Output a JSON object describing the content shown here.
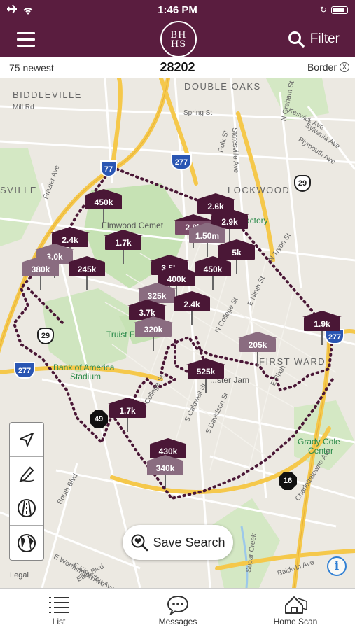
{
  "status_bar": {
    "time": "1:46 PM"
  },
  "header": {
    "logo_line1": "BH",
    "logo_line2": "HS",
    "filter_label": "Filter"
  },
  "info_bar": {
    "newest": "75 newest",
    "zip": "28202",
    "border_label": "Border",
    "border_close": "x"
  },
  "map": {
    "labels": {
      "biddleville": "BIDDLEVILLE",
      "double_oaks": "DOUBLE OAKS",
      "lockwood": "LOCKWOOD",
      "first_ward": "FIRST WARD",
      "sville": "SVILLE",
      "elmwood": "Elmwood Cemet",
      "truist": "Truist Field",
      "boa": "Bank of America",
      "stadium": "Stadium",
      "grady1": "Grady Cole",
      "grady2": "Center",
      "factory": "actory",
      "spring": "Spring St",
      "mill": "Mill Rd",
      "statesville": "Statesville Ave",
      "ngraham": "N Graham St",
      "ntryon": "N Tryon St",
      "ncollege": "N College St",
      "scaldwell": "S Caldwell St",
      "sdavidson": "S Davidson St",
      "south_blvd": "South Blvd",
      "east_blvd": "East Blvd",
      "charlottetowne": "Charlottetowne Ave",
      "sugar_creek": "Sugar Creek",
      "ninth": "E Ninth St",
      "sixth": "E Sixth",
      "keswick": "Keswick Ave",
      "sylvania": "Sylvania Ave",
      "plymouth": "Plymouth Ave",
      "polk": "Polk St",
      "frazier": "Frazier Ave",
      "jam": "...ster Jam",
      "kingston": "E Kingston Ave",
      "worthington": "E Worthington Ave",
      "baldwin": "Baldwin Ave",
      "college": "S College St"
    },
    "shields": {
      "i77": "77",
      "i277a": "277",
      "us29": "29",
      "i277b": "277",
      "i277c": "277",
      "us29b": "29",
      "nc49": "49",
      "nc16": "16"
    },
    "pins": [
      {
        "label": "450k",
        "style": "dark"
      },
      {
        "label": "2.6k",
        "style": "dark"
      },
      {
        "label": "2.9k",
        "style": "dark"
      },
      {
        "label": "1.50m",
        "style": "light"
      },
      {
        "label": "1.7k",
        "style": "dark"
      },
      {
        "label": "2.4k",
        "style": "dark"
      },
      {
        "label": "3.0k",
        "style": "light"
      },
      {
        "label": "380k",
        "style": "light"
      },
      {
        "label": "245k",
        "style": "dark"
      },
      {
        "label": "3.5k",
        "style": "dark"
      },
      {
        "label": "400k",
        "style": "dark"
      },
      {
        "label": "450k",
        "style": "dark"
      },
      {
        "label": "5k",
        "style": "dark"
      },
      {
        "label": "325k",
        "style": "light"
      },
      {
        "label": "2.4k",
        "style": "dark"
      },
      {
        "label": "3.7k",
        "style": "dark"
      },
      {
        "label": "320k",
        "style": "light"
      },
      {
        "label": "1.9k",
        "style": "dark"
      },
      {
        "label": "205k",
        "style": "light"
      },
      {
        "label": "525k",
        "style": "dark"
      },
      {
        "label": "1.7k",
        "style": "dark"
      },
      {
        "label": "430k",
        "style": "dark"
      },
      {
        "label": "340k",
        "style": "light"
      }
    ],
    "tools": [
      "navigation-arrow-icon",
      "draw-pencil-icon",
      "road-icon",
      "globe-icon"
    ],
    "save_search_label": "Save Search",
    "legal_label": "Legal",
    "info_label": "i"
  },
  "tabbar": {
    "items": [
      {
        "label": "List",
        "icon": "list-icon"
      },
      {
        "label": "Messages",
        "icon": "chat-bubble-icon"
      },
      {
        "label": "Home Scan",
        "icon": "house-scan-icon"
      }
    ]
  },
  "colors": {
    "brand": "#5a1d3f",
    "pin_dark": "#4a1736",
    "pin_light": "#8a6c80",
    "map_bg": "#ece9e2",
    "park": "#c6e2b4",
    "highway": "#f5c84b",
    "border_dots": "#4a1736"
  }
}
